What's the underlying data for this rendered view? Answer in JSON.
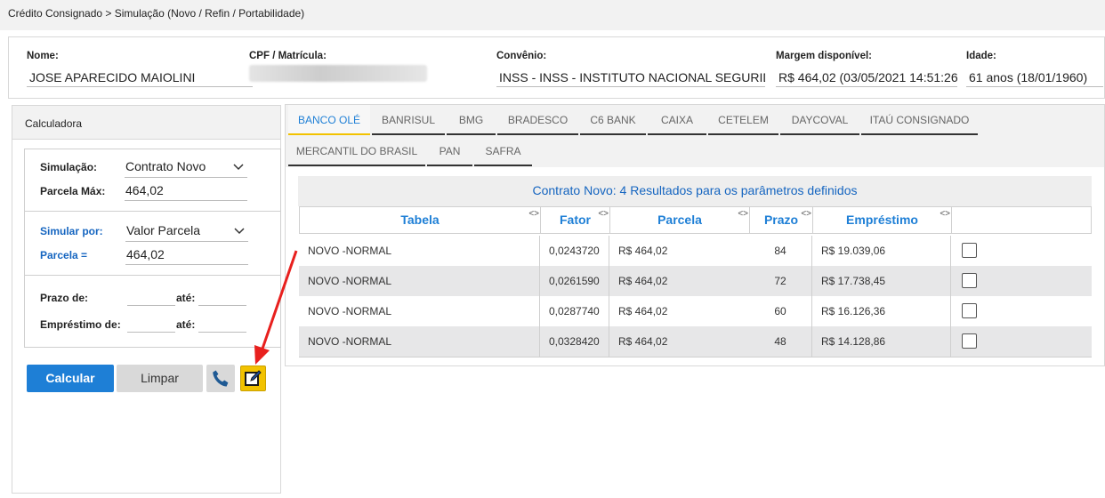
{
  "breadcrumb": "Crédito Consignado > Simulação (Novo / Refin / Portabilidade)",
  "client": {
    "nome_label": "Nome:",
    "nome": "JOSE APARECIDO MAIOLINI",
    "cpf_label": "CPF / Matrícula:",
    "convenio_label": "Convênio:",
    "convenio": "INSS - INSS - INSTITUTO NACIONAL SEGURIDAD",
    "margem_label": "Margem disponível:",
    "margem": "R$ 464,02 (03/05/2021 14:51:26",
    "idade_label": "Idade:",
    "idade": "61 anos (18/01/1960)"
  },
  "calc": {
    "title": "Calculadora",
    "simulacao_label": "Simulação:",
    "simulacao_value": "Contrato Novo",
    "parcela_max_label": "Parcela Máx:",
    "parcela_max_value": "464,02",
    "simular_por_label": "Simular por:",
    "simular_por_value": "Valor Parcela",
    "parcela_eq_label": "Parcela =",
    "parcela_eq_value": "464,02",
    "prazo_de_label": "Prazo de:",
    "ate_label": "até:",
    "emprestimo_de_label": "Empréstimo de:",
    "calcular_label": "Calcular",
    "limpar_label": "Limpar"
  },
  "tabs": [
    {
      "label": "BANCO OLÉ"
    },
    {
      "label": "BANRISUL"
    },
    {
      "label": "BMG"
    },
    {
      "label": "BRADESCO"
    },
    {
      "label": "C6 BANK"
    },
    {
      "label": "CAIXA"
    },
    {
      "label": "CETELEM"
    },
    {
      "label": "DAYCOVAL"
    },
    {
      "label": "ITAÚ CONSIGNADO"
    },
    {
      "label": "MERCANTIL DO BRASIL"
    },
    {
      "label": "PAN"
    },
    {
      "label": "SAFRA"
    }
  ],
  "results": {
    "title": "Contrato Novo: 4 Resultados para os parâmetros definidos",
    "columns": [
      "Tabela",
      "Fator",
      "Parcela",
      "Prazo",
      "Empréstimo"
    ],
    "sort_glyph": "<>",
    "rows": [
      {
        "tabela": "NOVO -NORMAL",
        "fator": "0,0243720",
        "parcela": "R$ 464,02",
        "prazo": "84",
        "emprestimo": "R$ 19.039,06"
      },
      {
        "tabela": "NOVO -NORMAL",
        "fator": "0,0261590",
        "parcela": "R$ 464,02",
        "prazo": "72",
        "emprestimo": "R$ 17.738,45"
      },
      {
        "tabela": "NOVO -NORMAL",
        "fator": "0,0287740",
        "parcela": "R$ 464,02",
        "prazo": "60",
        "emprestimo": "R$ 16.126,36"
      },
      {
        "tabela": "NOVO -NORMAL",
        "fator": "0,0328420",
        "parcela": "R$ 464,02",
        "prazo": "48",
        "emprestimo": "R$ 14.128,86"
      }
    ]
  },
  "colors": {
    "accent": "#1e7fd6",
    "tab_active_underline": "#f2c200",
    "annotation_arrow": "#e8201e"
  }
}
